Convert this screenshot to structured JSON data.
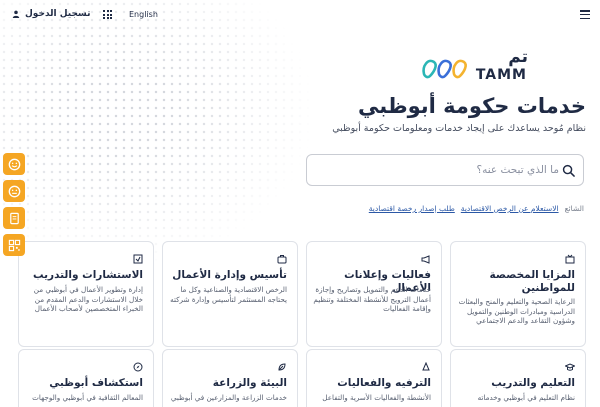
{
  "topbar": {
    "login_label": "تسجيل الدخول",
    "language": "English"
  },
  "logo": {
    "arabic": "تم",
    "english": "TAMM"
  },
  "hero": {
    "title": "خدمات حكومة أبوظبي",
    "subtitle": "نظام مُوحد يساعدك على إيجاد خدمات ومعلومات حكومة أبوظبي"
  },
  "search": {
    "placeholder": "ما الذي تبحث عنه؟"
  },
  "popular": {
    "label": "الشائع",
    "links": [
      "الاستعلام عن الرخص الاقتصادية",
      "طلب إصدار رخصة اقتصادية"
    ]
  },
  "cards": [
    {
      "title": "المزايا المخصصة للمواطنين",
      "description": "الرعاية الصحية والتعليم والمنح والبعثات الدراسية ومبادرات الوطنين والتمويل وشؤون التقاعد والدعم الاجتماعي",
      "icon": "benefits-icon"
    },
    {
      "title": "فعاليات وإعلانات الأعمال",
      "description": "خدمات الدعم والتمويل وتصاريح وإجازة أعمال الترويج للأنشطة المختلفة وتنظيم وإقامة الفعاليات",
      "icon": "megaphone-icon"
    },
    {
      "title": "تأسيس وإدارة الأعمال",
      "description": "الرخص الاقتصادية والصناعية وكل ما يحتاجه المستثمر لتأسيس وإدارة شركته",
      "icon": "briefcase-icon"
    },
    {
      "title": "الاستشارات والتدريب",
      "description": "إدارة وتطوير الأعمال في أبوظبي من خلال الاستشارات والدعم المقدم من الخبراء المتخصصين لأصحاب الأعمال",
      "icon": "consulting-icon"
    },
    {
      "title": "التعليم والتدريب",
      "description": "نظام التعليم في أبوظبي وخدماته",
      "icon": "graduation-icon"
    },
    {
      "title": "الترفيه والفعاليات",
      "description": "الأنشطة والفعاليات الأسرية والتفاعل",
      "icon": "entertainment-icon"
    },
    {
      "title": "البيئة والزراعة",
      "description": "خدمات الزراعة والمزارعين في أبوظبي",
      "icon": "leaf-icon"
    },
    {
      "title": "استكشاف أبوظبي",
      "description": "المعالم الثقافية في أبوظبي والوجهات",
      "icon": "explore-icon"
    }
  ],
  "side_buttons": [
    "feedback-happy-icon",
    "feedback-neutral-icon",
    "document-icon",
    "qr-icon"
  ],
  "colors": {
    "primary_text": "#1f2a44",
    "accent_orange": "#f5a623",
    "link_blue": "#2b58a6",
    "logo_teal": "#2bb6b5",
    "logo_blue": "#3a6fd8",
    "logo_yellow": "#f4b32f"
  }
}
